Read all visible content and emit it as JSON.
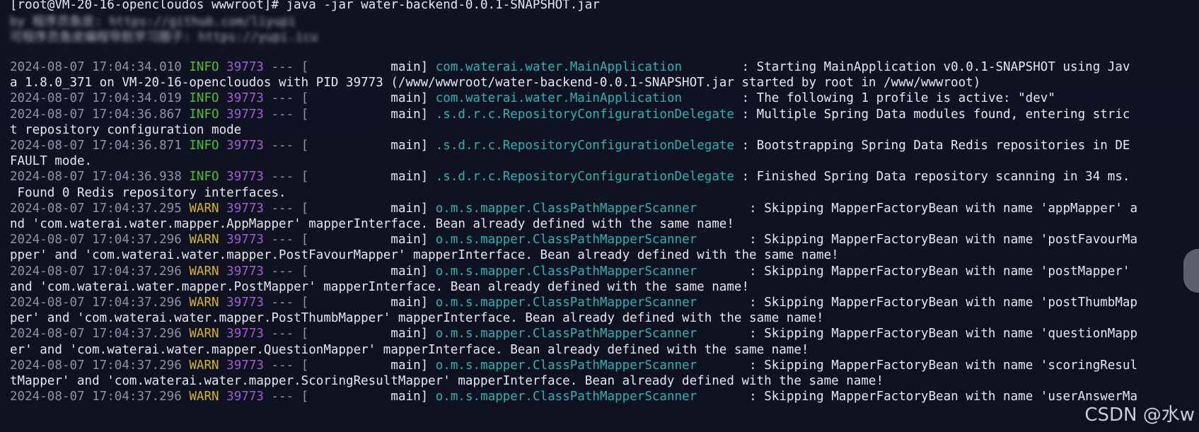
{
  "terminal": {
    "command_line": "[root@VM-20-16-opencloudos wwwroot]# java -jar water-backend-0.0.1-SNAPSHOT.jar",
    "blurred_line1": "by 程序员鱼皮: https://github.com/liyupi",
    "blurred_line2": "可程序员鱼皮编程导航学习圈子: https://yupi.icu",
    "logs": [
      {
        "ts": "2024-08-07 17:04:34.010",
        "level": "INFO",
        "pid": "39773",
        "sep": " --- [",
        "thread": "           main]",
        "logger": "com.waterai.water.MainApplication",
        "pad": "        ",
        "msg": ": Starting MainApplication v0.0.1-SNAPSHOT using Jav",
        "cont": "a 1.8.0_371 on VM-20-16-opencloudos with PID 39773 (/www/wwwroot/water-backend-0.0.1-SNAPSHOT.jar started by root in /www/wwwroot)"
      },
      {
        "ts": "2024-08-07 17:04:34.019",
        "level": "INFO",
        "pid": "39773",
        "sep": " --- [",
        "thread": "           main]",
        "logger": "com.waterai.water.MainApplication",
        "pad": "        ",
        "msg": ": The following 1 profile is active: \"dev\"",
        "cont": ""
      },
      {
        "ts": "2024-08-07 17:04:36.867",
        "level": "INFO",
        "pid": "39773",
        "sep": " --- [",
        "thread": "           main]",
        "logger": ".s.d.r.c.RepositoryConfigurationDelegate",
        "pad": " ",
        "msg": ": Multiple Spring Data modules found, entering stric",
        "cont": "t repository configuration mode"
      },
      {
        "ts": "2024-08-07 17:04:36.871",
        "level": "INFO",
        "pid": "39773",
        "sep": " --- [",
        "thread": "           main]",
        "logger": ".s.d.r.c.RepositoryConfigurationDelegate",
        "pad": " ",
        "msg": ": Bootstrapping Spring Data Redis repositories in DE",
        "cont": "FAULT mode."
      },
      {
        "ts": "2024-08-07 17:04:36.938",
        "level": "INFO",
        "pid": "39773",
        "sep": " --- [",
        "thread": "           main]",
        "logger": ".s.d.r.c.RepositoryConfigurationDelegate",
        "pad": " ",
        "msg": ": Finished Spring Data repository scanning in 34 ms.",
        "cont": " Found 0 Redis repository interfaces."
      },
      {
        "ts": "2024-08-07 17:04:37.295",
        "level": "WARN",
        "pid": "39773",
        "sep": " --- [",
        "thread": "           main]",
        "logger": "o.m.s.mapper.ClassPathMapperScanner",
        "pad": "       ",
        "msg": ": Skipping MapperFactoryBean with name 'appMapper' a",
        "cont": "nd 'com.waterai.water.mapper.AppMapper' mapperInterface. Bean already defined with the same name!"
      },
      {
        "ts": "2024-08-07 17:04:37.296",
        "level": "WARN",
        "pid": "39773",
        "sep": " --- [",
        "thread": "           main]",
        "logger": "o.m.s.mapper.ClassPathMapperScanner",
        "pad": "       ",
        "msg": ": Skipping MapperFactoryBean with name 'postFavourMa",
        "cont": "pper' and 'com.waterai.water.mapper.PostFavourMapper' mapperInterface. Bean already defined with the same name!"
      },
      {
        "ts": "2024-08-07 17:04:37.296",
        "level": "WARN",
        "pid": "39773",
        "sep": " --- [",
        "thread": "           main]",
        "logger": "o.m.s.mapper.ClassPathMapperScanner",
        "pad": "       ",
        "msg": ": Skipping MapperFactoryBean with name 'postMapper'",
        "cont": "and 'com.waterai.water.mapper.PostMapper' mapperInterface. Bean already defined with the same name!"
      },
      {
        "ts": "2024-08-07 17:04:37.296",
        "level": "WARN",
        "pid": "39773",
        "sep": " --- [",
        "thread": "           main]",
        "logger": "o.m.s.mapper.ClassPathMapperScanner",
        "pad": "       ",
        "msg": ": Skipping MapperFactoryBean with name 'postThumbMap",
        "cont": "per' and 'com.waterai.water.mapper.PostThumbMapper' mapperInterface. Bean already defined with the same name!"
      },
      {
        "ts": "2024-08-07 17:04:37.296",
        "level": "WARN",
        "pid": "39773",
        "sep": " --- [",
        "thread": "           main]",
        "logger": "o.m.s.mapper.ClassPathMapperScanner",
        "pad": "       ",
        "msg": ": Skipping MapperFactoryBean with name 'questionMapp",
        "cont": "er' and 'com.waterai.water.mapper.QuestionMapper' mapperInterface. Bean already defined with the same name!"
      },
      {
        "ts": "2024-08-07 17:04:37.296",
        "level": "WARN",
        "pid": "39773",
        "sep": " --- [",
        "thread": "           main]",
        "logger": "o.m.s.mapper.ClassPathMapperScanner",
        "pad": "       ",
        "msg": ": Skipping MapperFactoryBean with name 'scoringResul",
        "cont": "tMapper' and 'com.waterai.water.mapper.ScoringResultMapper' mapperInterface. Bean already defined with the same name!"
      },
      {
        "ts": "2024-08-07 17:04:37.296",
        "level": "WARN",
        "pid": "39773",
        "sep": " --- [",
        "thread": "           main]",
        "logger": "o.m.s.mapper.ClassPathMapperScanner",
        "pad": "       ",
        "msg": ": Skipping MapperFactoryBean with name 'userAnswerMa",
        "cont": ""
      }
    ]
  },
  "watermark": "CSDN @水w",
  "colors": {
    "background": "#0e1220",
    "info": "#4fbf34",
    "warn": "#d7b42a",
    "pid": "#a55bd1",
    "logger": "#2eb3b3",
    "timestamp": "#8d93a6"
  }
}
